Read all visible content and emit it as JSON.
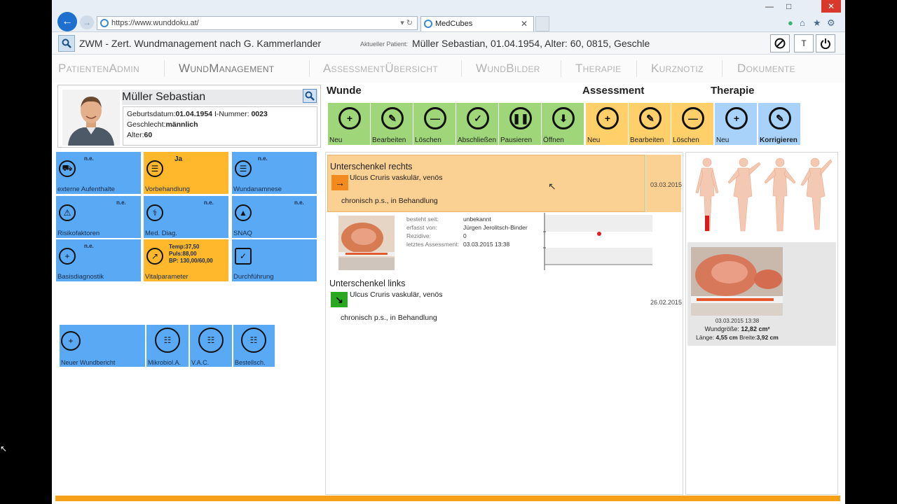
{
  "browser": {
    "url": "https://www.wunddoku.at/",
    "tab_title": "MedCubes"
  },
  "header": {
    "app_title": "ZWM - Zert. Wundmanagement nach G. Kammerlander",
    "patient_label": "Aktueller Patient:",
    "patient_value": "Müller Sebastian, 01.04.1954, Alter: 60, 0815, Geschlech",
    "t_button": "T"
  },
  "nav": {
    "items": [
      "PatientenAdmin",
      "WundManagement",
      "AssessmentÜbersicht",
      "WundBilder",
      "Therapie",
      "Kurznotiz",
      "Dokumente"
    ]
  },
  "patient": {
    "name": "Müller Sebastian",
    "dob_label": "Geburtsdatum:",
    "dob": "01.04.1954",
    "id_label": "I-Nummer:",
    "id": "0023",
    "gender_label": "Geschlecht:",
    "gender": "männlich",
    "age_label": "Alter:",
    "age": "60"
  },
  "tiles": [
    {
      "label": "externe Aufenthalte",
      "badge": "n.e.",
      "color": "blue"
    },
    {
      "label": "Vorbehandlung",
      "badge": "Ja",
      "color": "orange"
    },
    {
      "label": "Wundanamnese",
      "badge": "n.e.",
      "color": "blue"
    },
    {
      "label": "Risikofaktoren",
      "badge": "n.e.",
      "color": "blue"
    },
    {
      "label": "Med. Diag.",
      "badge": "n.e.",
      "color": "blue"
    },
    {
      "label": "SNAQ",
      "badge": "n.e.",
      "color": "blue"
    },
    {
      "label": "Basisdiagnostik",
      "badge": "n.e.",
      "color": "blue"
    },
    {
      "label": "Vitalparameter",
      "badge": "",
      "color": "orange"
    },
    {
      "label": "Durchführung",
      "badge": "",
      "color": "blue"
    }
  ],
  "vitals": {
    "temp": "Temp:37,50",
    "puls": "Puls:88,00",
    "bp": "BP: 130,00/60,00"
  },
  "bottom_tiles": [
    "Neuer Wundbericht",
    "Mikrobiol.A.",
    "V.A.C.",
    "Bestellsch."
  ],
  "sections": {
    "wunde": "Wunde",
    "assessment": "Assessment",
    "therapie": "Therapie"
  },
  "toolbar": [
    {
      "label": "Neu",
      "icon": "plus-icon",
      "group": "wunde"
    },
    {
      "label": "Bearbeiten",
      "icon": "pencil-icon",
      "group": "wunde"
    },
    {
      "label": "Löschen",
      "icon": "minus-icon",
      "group": "wunde"
    },
    {
      "label": "Abschließen",
      "icon": "check-icon",
      "group": "wunde"
    },
    {
      "label": "Pausieren",
      "icon": "pause-icon",
      "group": "wunde"
    },
    {
      "label": "Öffnen",
      "icon": "download-icon",
      "group": "wunde"
    },
    {
      "label": "Neu",
      "icon": "plus-icon",
      "group": "assessment"
    },
    {
      "label": "Bearbeiten",
      "icon": "pencil-icon",
      "group": "assessment"
    },
    {
      "label": "Löschen",
      "icon": "minus-icon",
      "group": "assessment"
    },
    {
      "label": "Neu",
      "icon": "plus-icon",
      "group": "therapie"
    },
    {
      "label": "Korrigieren",
      "icon": "pencil-icon",
      "group": "therapie"
    }
  ],
  "wounds": [
    {
      "title": "Unterschenkel rechts",
      "diagnosis": "Ulcus Cruris vaskulär, venös",
      "status": "chronisch p.s., in Behandlung",
      "date": "03.03.2015"
    },
    {
      "title": "Unterschenkel links",
      "diagnosis": "Ulcus Cruris vaskulär, venös",
      "status": "chronisch p.s., in Behandlung",
      "date": "26.02.2015"
    }
  ],
  "detail": {
    "besteht_label": "besteht seit:",
    "besteht_value": "unbekannt",
    "erfasst_label": "erfasst von:",
    "erfasst_value": "Jürgen Jerolitsch-Binder",
    "rezidive_label": "Rezidive:",
    "rezidive_value": "0",
    "assessment_label": "letztes Assessment:",
    "assessment_value": "03.03.2015 13:38"
  },
  "photo": {
    "timestamp": "03.03.2015 13:38",
    "size_label": "Wundgröße:",
    "size_value": "12,82 cm²",
    "length_label": "Länge:",
    "length_value": "4,55 cm",
    "width_label": "Breite:",
    "width_value": "3,92 cm"
  },
  "colors": {
    "tile_blue": "#5aa9f4",
    "tile_orange": "#ffb82b",
    "wunde_green": "#9fd67a",
    "assessment_yellow": "#ffd06a",
    "therapie_blue": "#a9d2fb",
    "selected_wound": "#fbd093",
    "footer_orange": "#f6a019"
  }
}
